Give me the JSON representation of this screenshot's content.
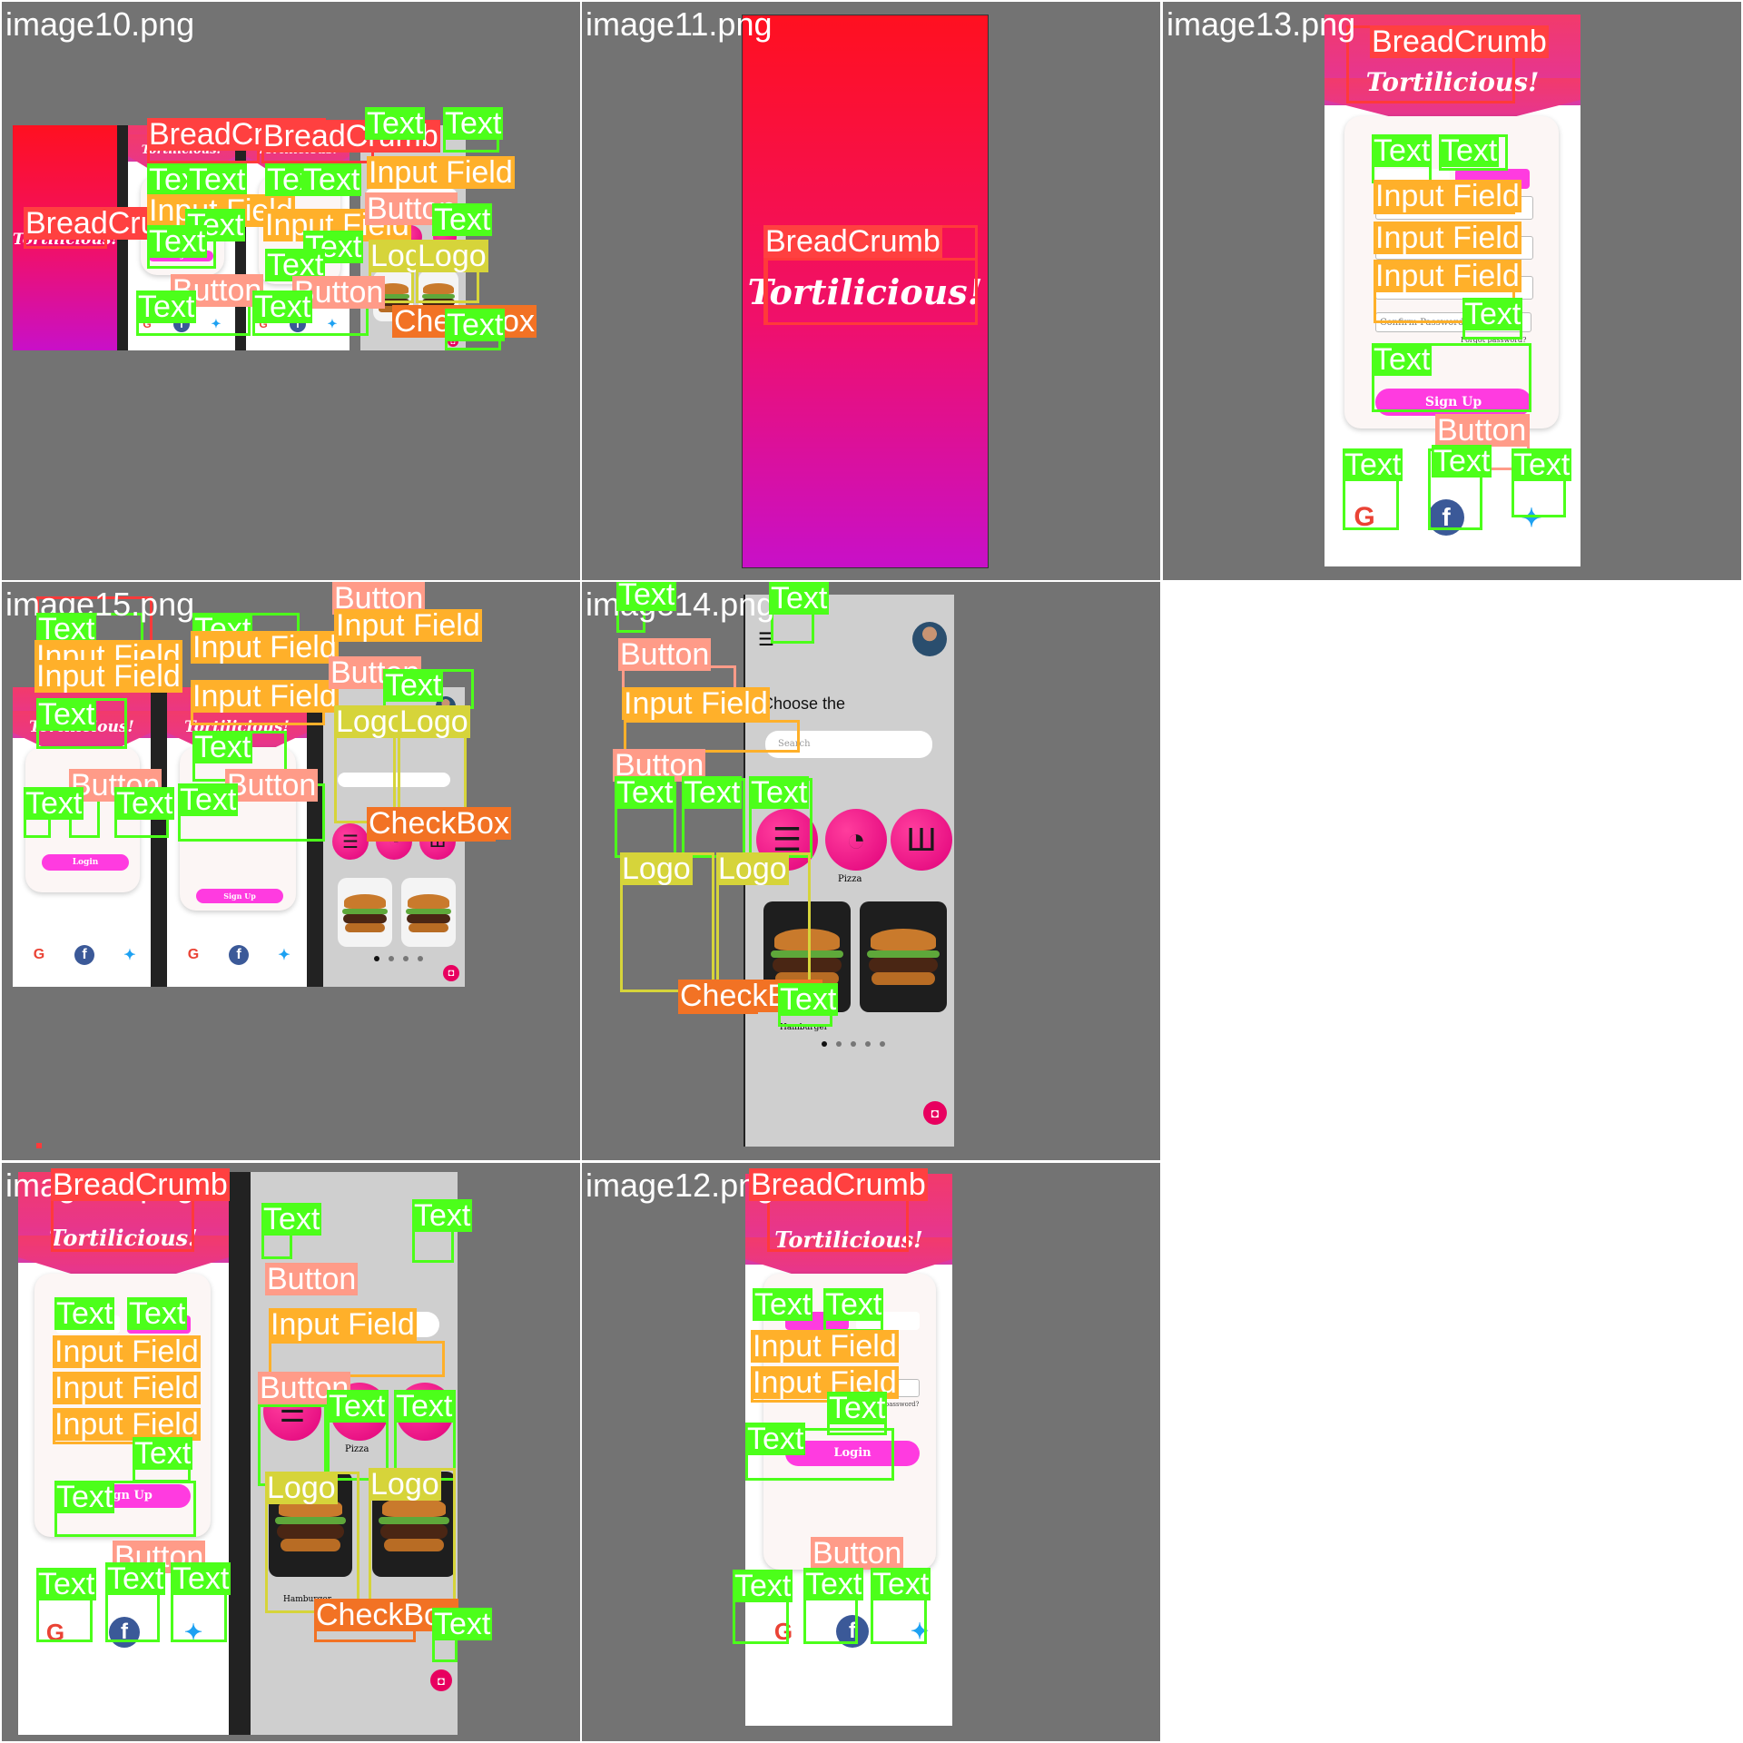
{
  "tiles": {
    "t1": "image10.png",
    "t2": "image11.png",
    "t3": "image13.png",
    "t4": "image15.png",
    "t5": "image14.png",
    "t6": "image16.png",
    "t7": "image12.png"
  },
  "labels": {
    "text": "Text",
    "breadcrumb": "BreadCrumb",
    "input": "Input Field",
    "button": "Button",
    "logo": "Logo",
    "checkbox": "CheckBox"
  },
  "app": {
    "brand": "Tortilicious!",
    "signup": "Sign Up",
    "login": "Login",
    "confirm_password": "Confirm Password",
    "password": "Password",
    "forgot": "Forgot password?",
    "choose": "Choose the",
    "search_placeholder": "Search",
    "pizza": "Pizza",
    "hamburger": "Hamburger"
  },
  "colors": {
    "text": "#4cff1a",
    "breadcrumb": "#ff4040",
    "input": "#ffb02a",
    "button": "#ff9b88",
    "logo": "#d6d43a",
    "checkbox": "#f27224",
    "accent": "#ff3be0"
  },
  "icons": [
    "google-icon",
    "facebook-icon",
    "twitter-icon",
    "burger-icon",
    "pizza-icon",
    "fries-icon",
    "cart-icon",
    "menu-icon",
    "search-icon",
    "avatar-icon"
  ]
}
